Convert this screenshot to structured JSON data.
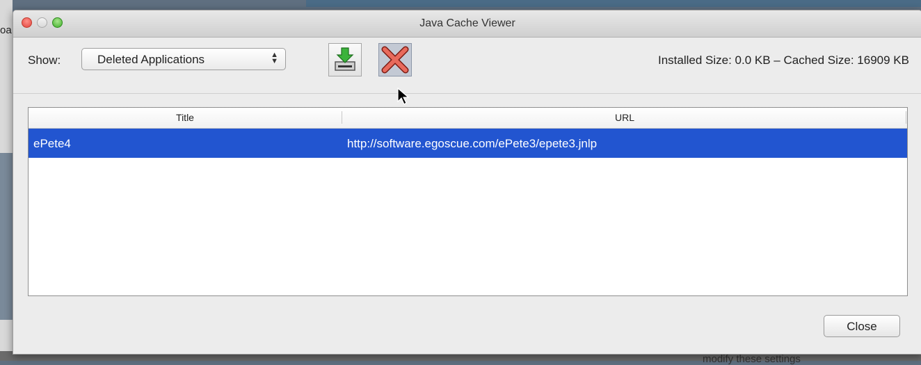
{
  "window": {
    "title": "Java Cache Viewer"
  },
  "background": {
    "left_fragment": "oa",
    "bottom_fragment": "modify these settings"
  },
  "toolbar": {
    "show_label": "Show:",
    "show_select": {
      "selected": "Deleted Applications"
    },
    "install_button_icon": "install-download-icon",
    "delete_button_icon": "delete-x-icon",
    "size_info": "Installed Size:  0.0 KB – Cached Size:  16909 KB"
  },
  "table": {
    "columns": [
      "Title",
      "URL"
    ],
    "rows": [
      {
        "title": "ePete4",
        "url": "http://software.egoscue.com/ePete3/epete3.jnlp",
        "selected": true
      }
    ]
  },
  "footer": {
    "close_label": "Close"
  },
  "colors": {
    "selection": "#2255d0",
    "window_bg": "#ececec"
  }
}
